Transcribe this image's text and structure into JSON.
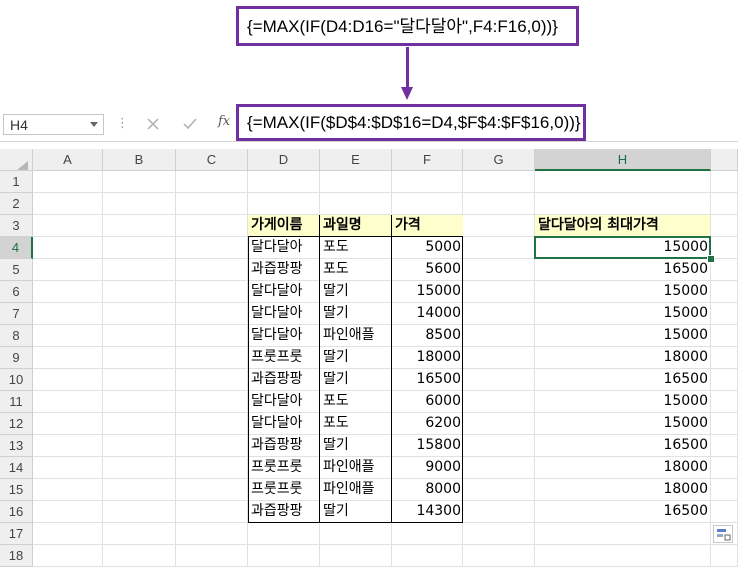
{
  "callout_top": {
    "formula": "{=MAX(IF(D4:D16=\"달다달아\",F4:F16,0))}"
  },
  "formula_bar": {
    "name_box": "H4",
    "fx_label": "fx",
    "formula": "{=MAX(IF($D$4:$D$16=D4,$F$4:$F$16,0))}",
    "cancel_icon": "x-icon",
    "enter_icon": "check-icon"
  },
  "columns": [
    "A",
    "B",
    "C",
    "D",
    "E",
    "F",
    "G",
    "H"
  ],
  "selected_column": "H",
  "selected_cell": "H4",
  "rows": [
    "1",
    "2",
    "3",
    "4",
    "5",
    "6",
    "7",
    "8",
    "9",
    "10",
    "11",
    "12",
    "13",
    "14",
    "15",
    "16",
    "17",
    "18"
  ],
  "table": {
    "headers": [
      "가게이름",
      "과일명",
      "가격"
    ],
    "header_color": "#ffffcc",
    "rows": [
      [
        "달다달아",
        "포도",
        "5000"
      ],
      [
        "과즙팡팡",
        "포도",
        "5600"
      ],
      [
        "달다달아",
        "딸기",
        "15000"
      ],
      [
        "달다달아",
        "딸기",
        "14000"
      ],
      [
        "달다달아",
        "파인애플",
        "8500"
      ],
      [
        "프룻프룻",
        "딸기",
        "18000"
      ],
      [
        "과즙팡팡",
        "딸기",
        "16500"
      ],
      [
        "달다달아",
        "포도",
        "6000"
      ],
      [
        "달다달아",
        "포도",
        "6200"
      ],
      [
        "과즙팡팡",
        "딸기",
        "15800"
      ],
      [
        "프룻프룻",
        "파인애플",
        "9000"
      ],
      [
        "프룻프룻",
        "파인애플",
        "8000"
      ],
      [
        "과즙팡팡",
        "딸기",
        "14300"
      ]
    ]
  },
  "result": {
    "header": "달다달아의 최대가격",
    "values": [
      "15000",
      "16500",
      "15000",
      "15000",
      "15000",
      "18000",
      "16500",
      "15000",
      "15000",
      "16500",
      "18000",
      "18000",
      "16500"
    ]
  },
  "colors": {
    "accent": "#7030a0",
    "selection": "#217346"
  }
}
